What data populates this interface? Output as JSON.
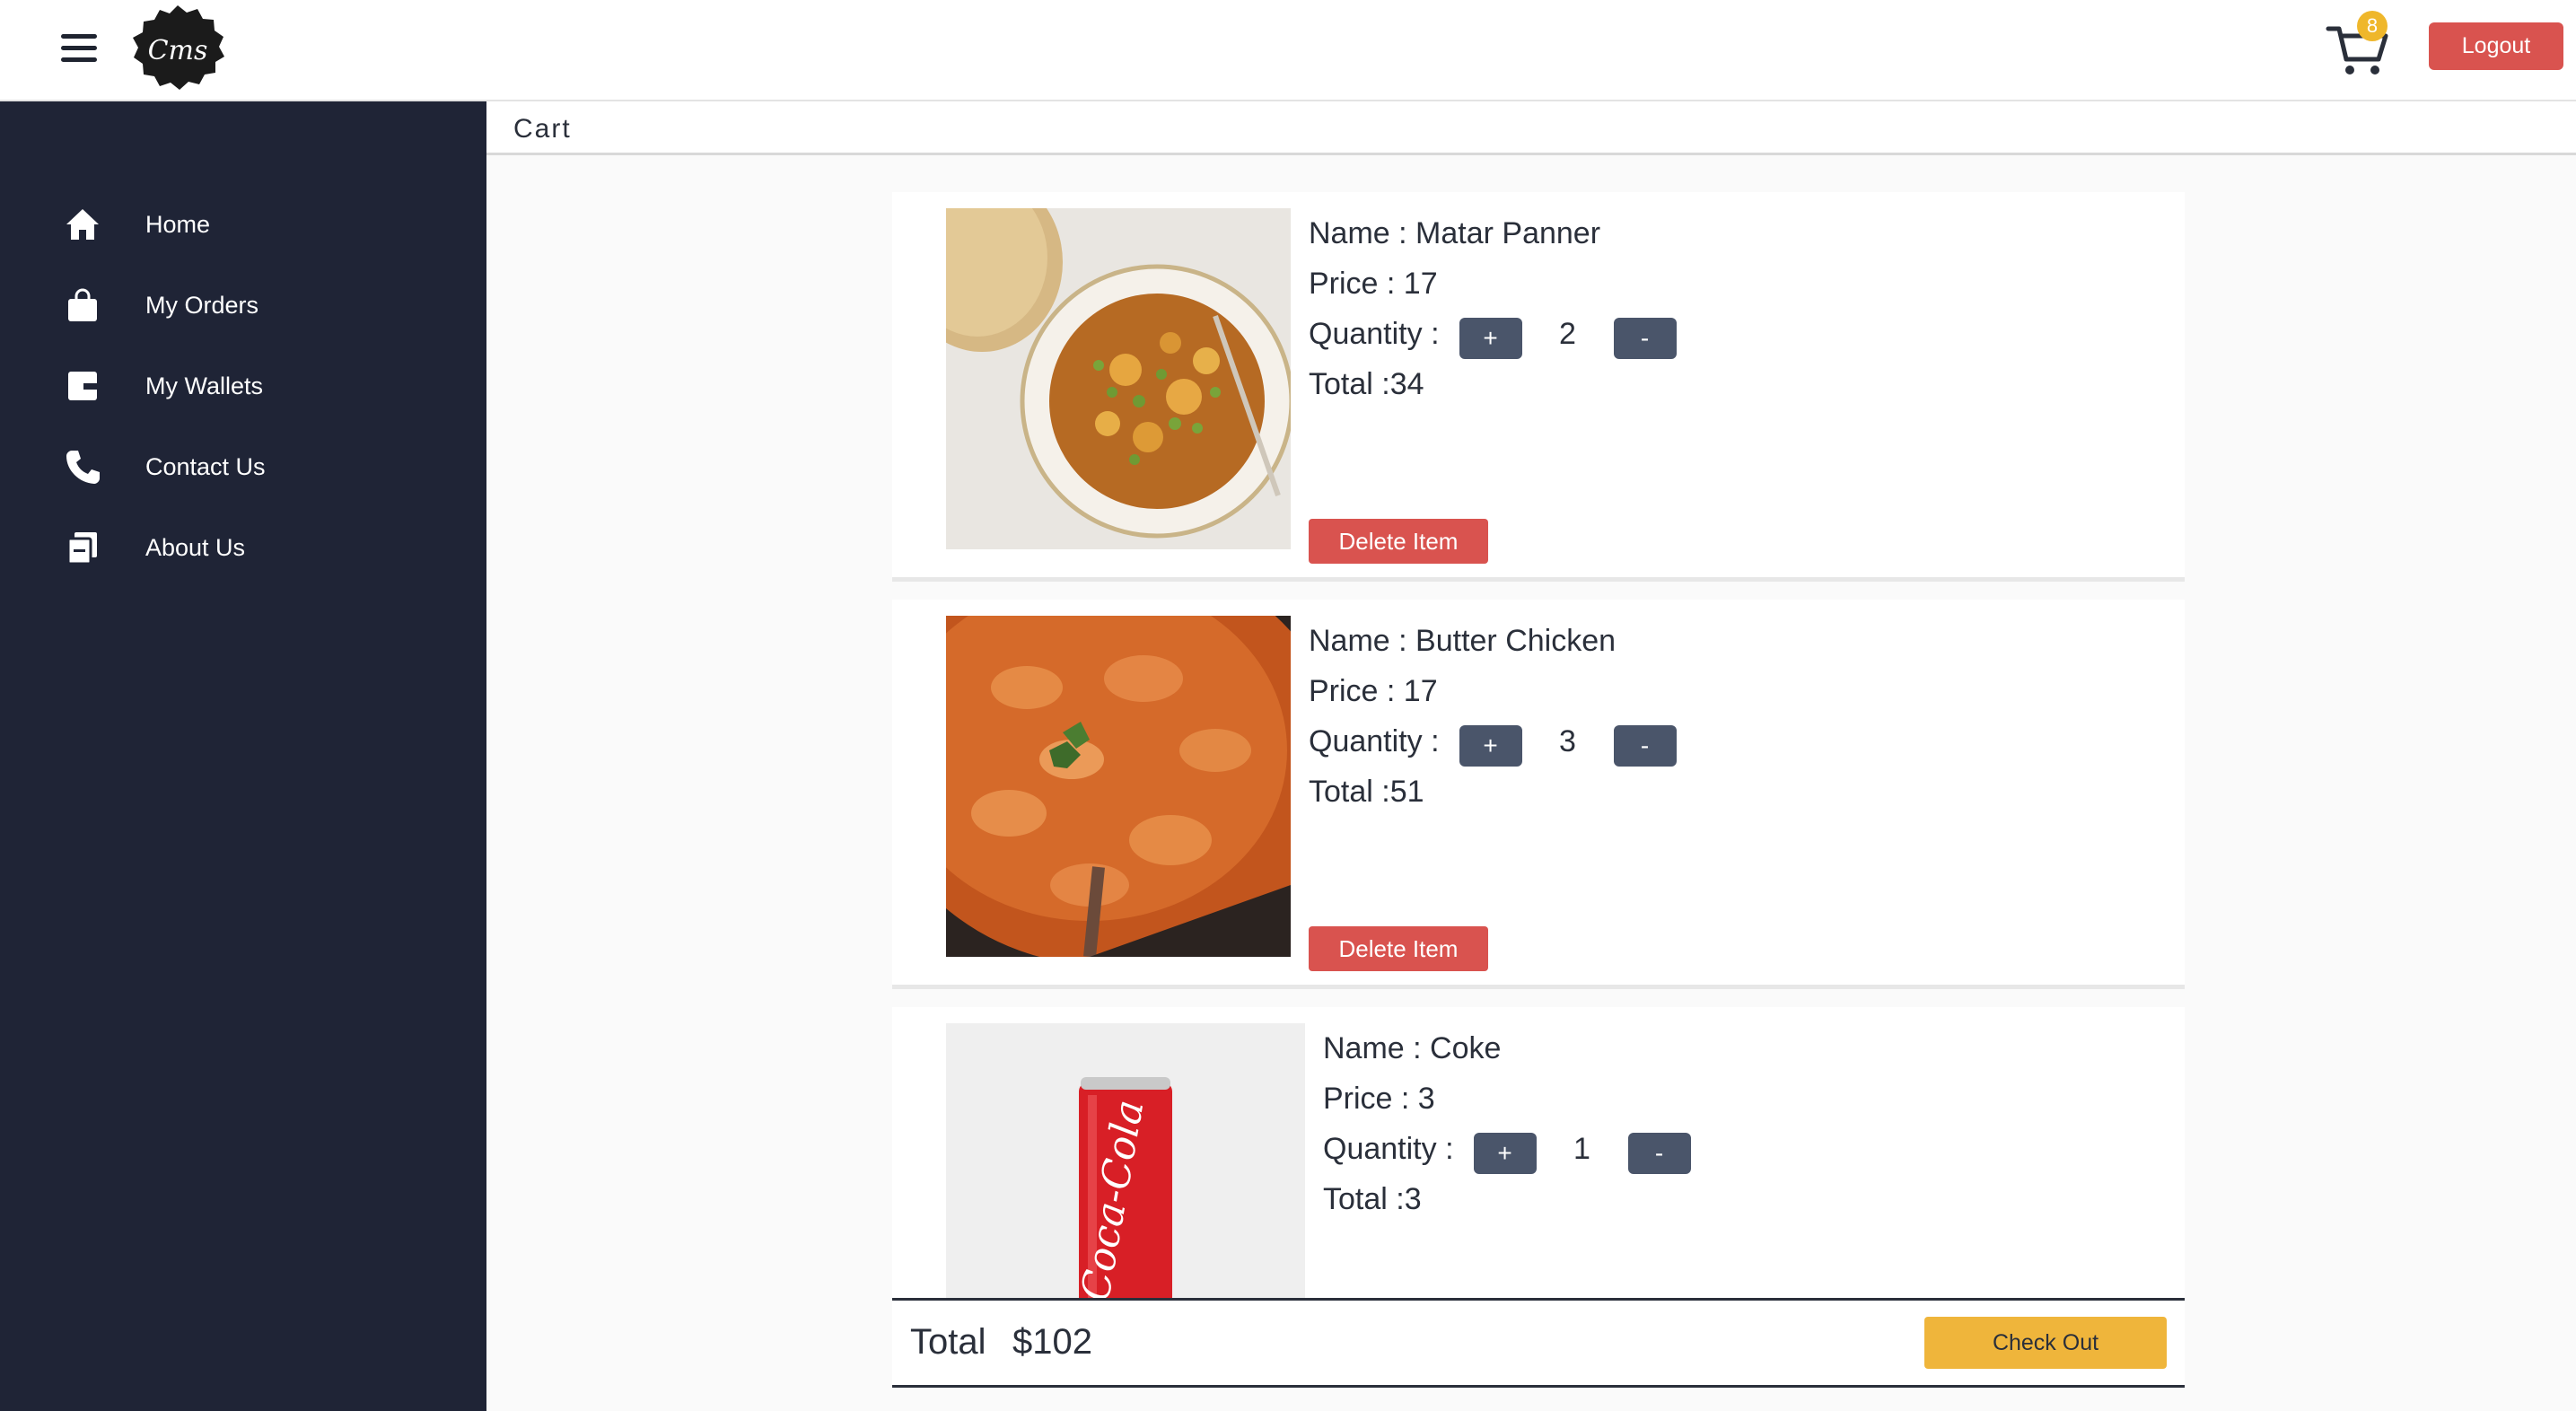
{
  "header": {
    "logo_text": "Cms",
    "cart_count": "8",
    "logout_label": "Logout",
    "icons": {
      "menu": "hamburger-menu-icon",
      "cart": "shopping-cart-icon"
    }
  },
  "sidebar": {
    "items": [
      {
        "label": "Home",
        "icon": "home-icon"
      },
      {
        "label": "My Orders",
        "icon": "shopping-bag-icon"
      },
      {
        "label": "My Wallets",
        "icon": "wallet-icon"
      },
      {
        "label": "Contact Us",
        "icon": "phone-icon"
      },
      {
        "label": "About Us",
        "icon": "copy-icon"
      }
    ]
  },
  "page": {
    "title": "Cart"
  },
  "cart": {
    "items": [
      {
        "name": "Name : Matar Panner",
        "price": "Price : 17",
        "quantity_label": "Quantity :",
        "plus": "+",
        "quantity": "2",
        "minus": "-",
        "total": "Total :34",
        "delete_label": "Delete Item",
        "image": "matar-panner-photo"
      },
      {
        "name": "Name : Butter Chicken",
        "price": "Price : 17",
        "quantity_label": "Quantity :",
        "plus": "+",
        "quantity": "3",
        "minus": "-",
        "total": "Total :51",
        "delete_label": "Delete Item",
        "image": "butter-chicken-photo"
      },
      {
        "name": "Name : Coke",
        "price": "Price : 3",
        "quantity_label": "Quantity :",
        "plus": "+",
        "quantity": "1",
        "minus": "-",
        "total": "Total :3",
        "image": "coke-can-photo"
      }
    ],
    "total_label": "Total",
    "total_value": "$102",
    "checkout_label": "Check Out"
  },
  "colors": {
    "sidebar_bg": "#1f2436",
    "danger": "#d9534f",
    "accent": "#efb53b",
    "qty_button": "#4a556a"
  }
}
